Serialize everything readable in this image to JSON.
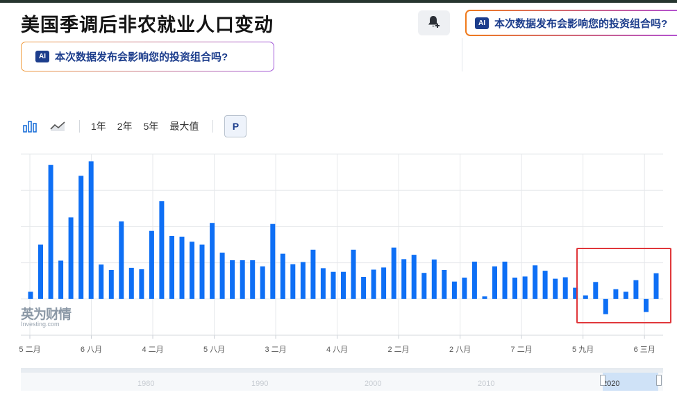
{
  "header": {
    "title": "美国季调后非农就业人口变动",
    "ai_banner_text": "本次数据发布会影响您的投资组合吗?",
    "ai_badge": "AI",
    "bell_icon": "bell-add-icon"
  },
  "toolbar": {
    "chart_type_icons": [
      "bar-chart-icon",
      "area-chart-icon"
    ],
    "ranges": [
      "1年",
      "2年",
      "5年",
      "最大值"
    ],
    "p_button": "P"
  },
  "watermark": {
    "cn": "英为财情",
    "en": "Investing.com"
  },
  "navigator": {
    "labels": [
      "1980",
      "1990",
      "2000",
      "2010",
      "2020"
    ]
  },
  "colors": {
    "bar": "#0e6ff5",
    "highlight_box": "#e0373b",
    "grid": "#e6e8eb"
  },
  "chart_data": {
    "type": "bar",
    "title": "美国季调后非农就业人口变动",
    "x_tick_labels": [
      "5 二月",
      "6 八月",
      "4 二月",
      "5 八月",
      "3 二月",
      "4 八月",
      "2 二月",
      "2 八月",
      "7 二月",
      "5 九月",
      "6 三月"
    ],
    "values": [
      0.2,
      1.5,
      3.7,
      1.06,
      2.25,
      3.4,
      3.8,
      0.95,
      0.8,
      2.14,
      0.86,
      0.82,
      1.88,
      2.7,
      1.74,
      1.72,
      1.58,
      1.5,
      2.1,
      1.28,
      1.07,
      1.07,
      1.07,
      0.9,
      2.07,
      1.25,
      0.96,
      1.02,
      1.36,
      0.85,
      0.75,
      0.75,
      1.36,
      0.61,
      0.81,
      0.87,
      1.42,
      1.1,
      1.22,
      0.72,
      1.09,
      0.8,
      0.48,
      0.59,
      1.03,
      0.07,
      0.9,
      1.03,
      0.59,
      0.62,
      0.93,
      0.78,
      0.56,
      0.6,
      0.31,
      0.1,
      0.47,
      -0.42,
      0.27,
      0.2,
      0.52,
      -0.36,
      0.71
    ],
    "ylim": [
      -1.0,
      4.0
    ],
    "grid": true,
    "legend": "none",
    "highlight": {
      "from_index": 55,
      "to_index": 62
    }
  }
}
